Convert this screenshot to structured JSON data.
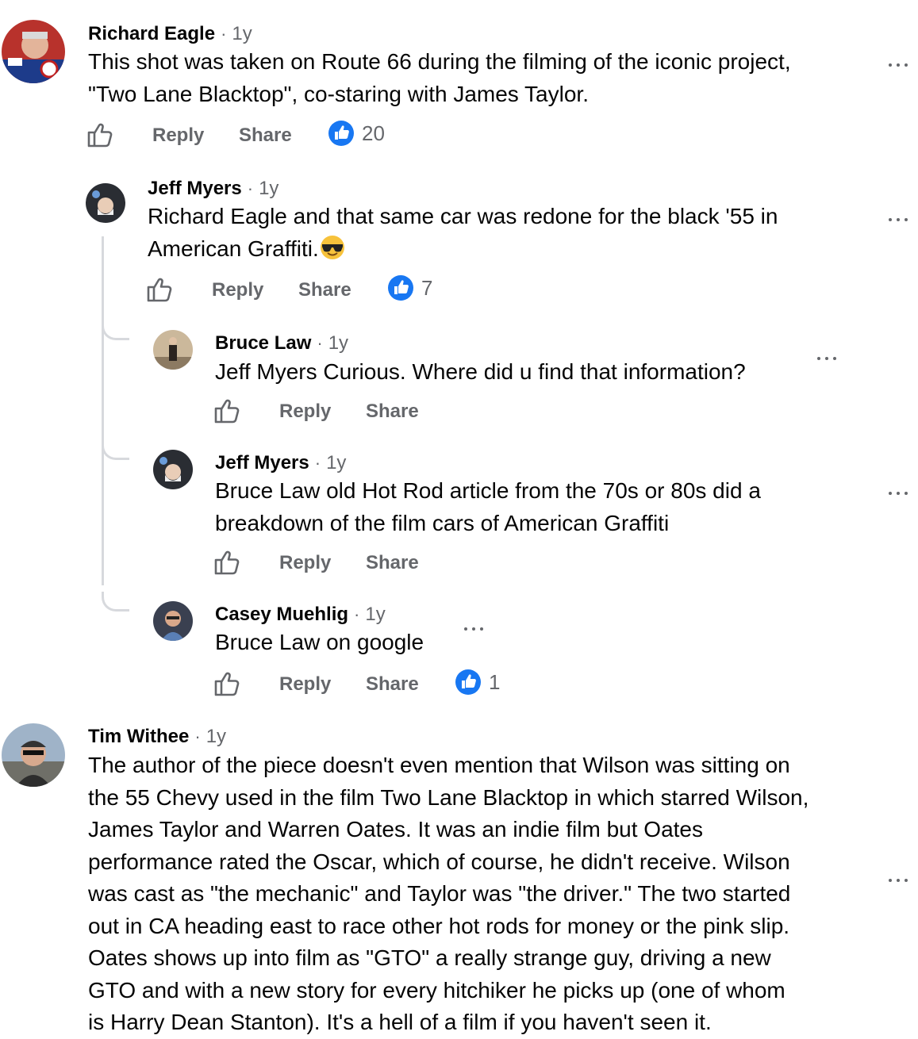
{
  "comments": [
    {
      "name": "Richard Eagle",
      "time": "1y",
      "text": "This shot was taken on Route 66 during the filming of the iconic project,\n\"Two Lane Blacktop\", co-staring with James Taylor.",
      "reply": "Reply",
      "share": "Share",
      "reactions": "20"
    },
    {
      "name": "Jeff Myers",
      "time": "1y",
      "text": "Richard Eagle and that same car was redone for the black '55 in\nAmerican Graffiti.",
      "emoji": "smiling-face-with-sunglasses",
      "reply": "Reply",
      "share": "Share",
      "reactions": "7"
    },
    {
      "name": "Bruce Law",
      "time": "1y",
      "text": "Jeff Myers Curious. Where did u find that information?",
      "reply": "Reply",
      "share": "Share"
    },
    {
      "name": "Jeff Myers",
      "time": "1y",
      "text": "Bruce Law old Hot Rod article from the 70s or 80s did a\nbreakdown of the film cars of American Graffiti",
      "reply": "Reply",
      "share": "Share"
    },
    {
      "name": "Casey Muehlig",
      "time": "1y",
      "text": "Bruce Law on google",
      "reply": "Reply",
      "share": "Share",
      "reactions": "1"
    },
    {
      "name": "Tim Withee",
      "time": "1y",
      "text": "The author of the piece doesn't even mention that Wilson was sitting on\nthe 55 Chevy used in the film Two Lane Blacktop in which starred Wilson,\nJames Taylor and Warren Oates. It was an indie film but Oates\nperformance rated the Oscar, which of course, he didn't receive. Wilson\nwas cast as \"the mechanic\" and Taylor was \"the driver.\" The two started\nout in CA heading east to race other hot rods for money or the pink slip.\nOates shows up into film as \"GTO\" a really strange guy, driving a new\nGTO and with a new story for every hitchiker he picks up (one of whom\nis Harry Dean Stanton). It's a hell of a film if you haven't seen it."
    }
  ],
  "separator": "·",
  "colors": {
    "secondary_text": "#65676b",
    "like_blue": "#1877f2",
    "thread_line": "#d7d9dd"
  },
  "icons": {
    "like": "thumbs-up-outline-icon",
    "reaction": "like-reaction-icon",
    "more": "more-options-icon"
  }
}
